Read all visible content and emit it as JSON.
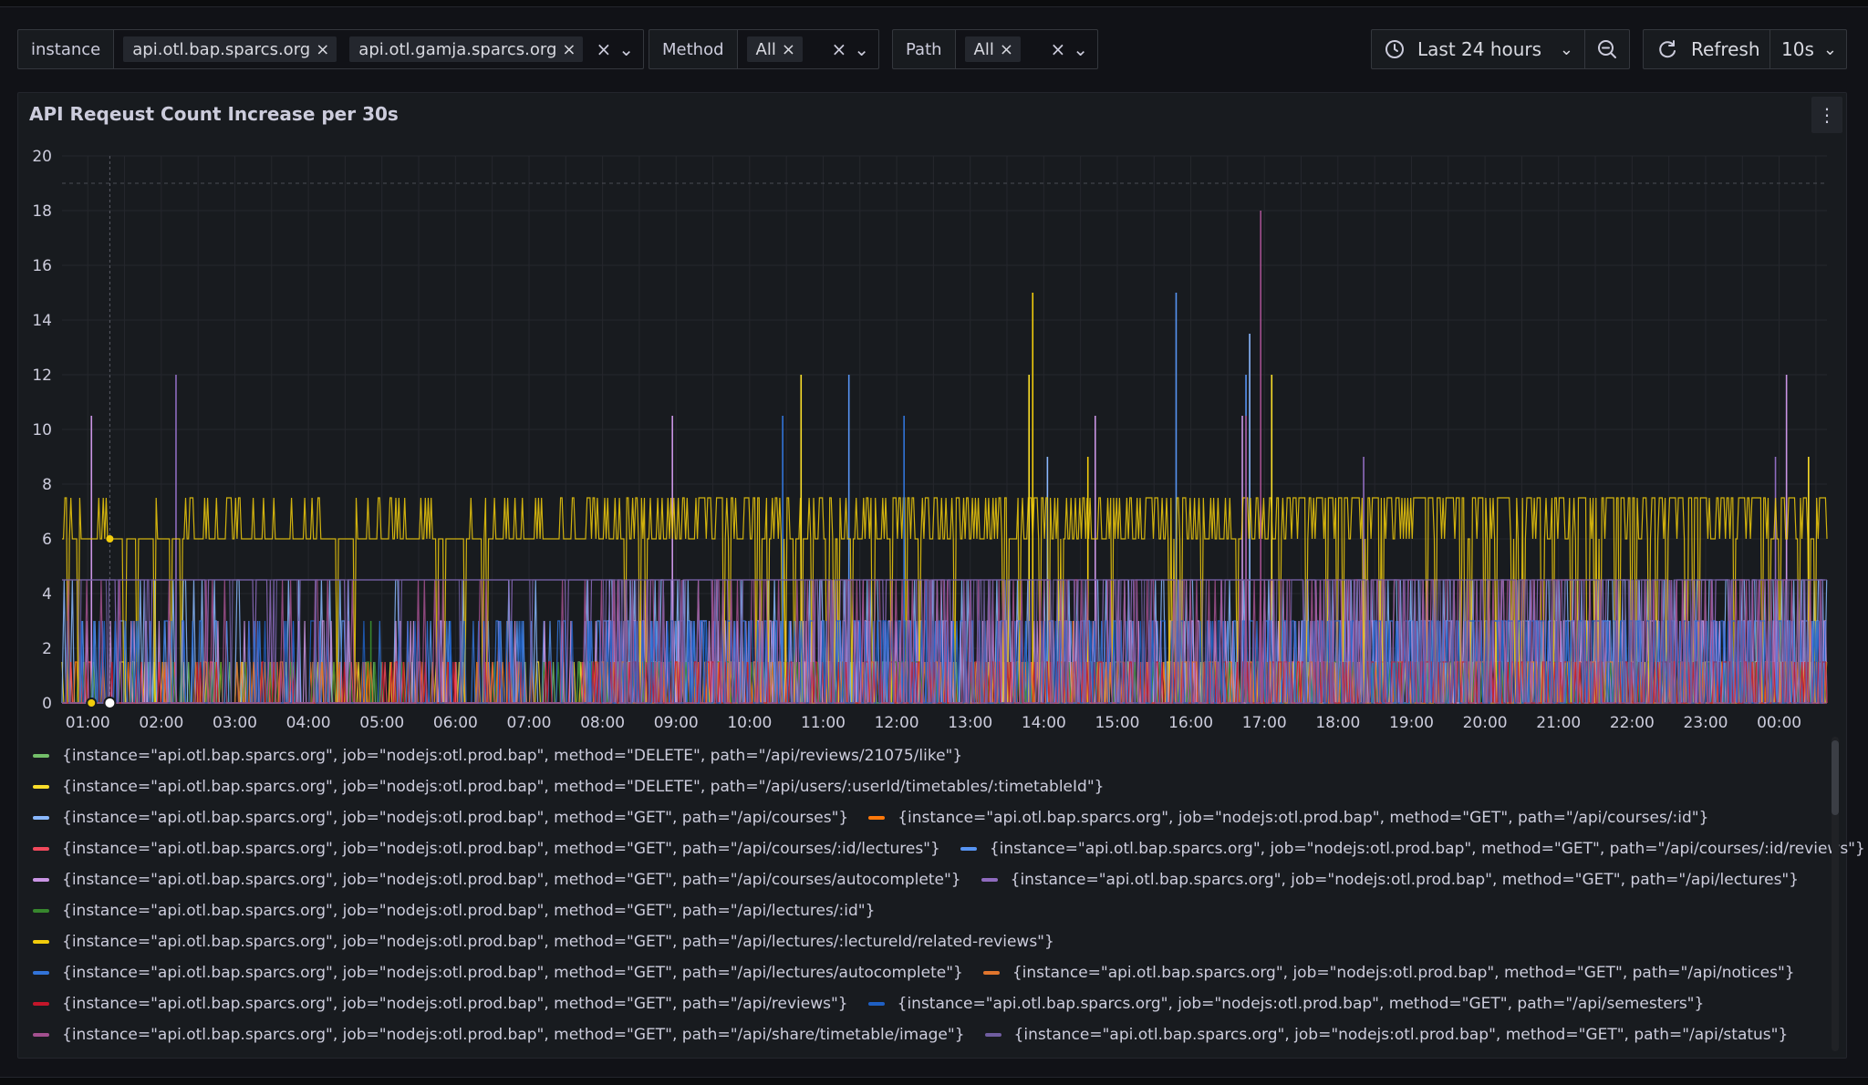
{
  "toolbar": {
    "instance": {
      "label": "instance",
      "values": [
        "api.otl.bap.sparcs.org",
        "api.otl.gamja.sparcs.org"
      ]
    },
    "method": {
      "label": "Method",
      "values": [
        "All"
      ]
    },
    "path": {
      "label": "Path",
      "values": [
        "All"
      ]
    },
    "time_range": "Last 24 hours",
    "refresh_label": "Refresh",
    "refresh_interval": "10s"
  },
  "panel": {
    "title": "API Reqeust Count Increase per 30s"
  },
  "chart_data": {
    "type": "line",
    "title": "API Reqeust Count Increase per 30s",
    "xlabel": "",
    "ylabel": "",
    "ylim": [
      0,
      20
    ],
    "yticks": [
      "0",
      "2",
      "4",
      "6",
      "8",
      "10",
      "12",
      "14",
      "16",
      "18",
      "20"
    ],
    "xticks": [
      "01:00",
      "02:00",
      "03:00",
      "04:00",
      "05:00",
      "06:00",
      "07:00",
      "08:00",
      "09:00",
      "10:00",
      "11:00",
      "12:00",
      "13:00",
      "14:00",
      "15:00",
      "16:00",
      "17:00",
      "18:00",
      "19:00",
      "20:00",
      "21:00",
      "22:00",
      "23:00",
      "00:00"
    ],
    "x_range_hours": [
      0.65,
      24.65
    ],
    "threshold_y": 19,
    "grid": true,
    "legend_position": "bottom",
    "series": [
      {
        "name": "{instance=\"api.otl.bap.sparcs.org\", job=\"nodejs:otl.prod.bap\", method=\"DELETE\", path=\"/api/reviews/21075/like\"}",
        "color": "#73bf69",
        "level": 1.5,
        "base": 0,
        "spikes": [
          [
            16.85,
            3
          ],
          [
            23.7,
            3
          ]
        ]
      },
      {
        "name": "{instance=\"api.otl.bap.sparcs.org\", job=\"nodejs:otl.prod.bap\", method=\"DELETE\", path=\"/api/users/:userId/timetables/:timetableId\"}",
        "color": "#fade2a",
        "level": 1.5,
        "base": 0,
        "spikes": [
          [
            10.7,
            12
          ],
          [
            13.8,
            12
          ],
          [
            17.1,
            12
          ],
          [
            24.4,
            9
          ]
        ]
      },
      {
        "name": "{instance=\"api.otl.bap.sparcs.org\", job=\"nodejs:otl.prod.bap\", method=\"GET\", path=\"/api/courses\"}",
        "color": "#8ab8ff",
        "level": 4.5,
        "base": 0,
        "spikes": [
          [
            14.05,
            9
          ],
          [
            16.8,
            13.5
          ]
        ]
      },
      {
        "name": "{instance=\"api.otl.bap.sparcs.org\", job=\"nodejs:otl.prod.bap\", method=\"GET\", path=\"/api/courses/:id\"}",
        "color": "#ff780a",
        "level": 1.5,
        "base": 0,
        "spikes": [
          [
            9.7,
            3
          ],
          [
            14.4,
            3
          ]
        ]
      },
      {
        "name": "{instance=\"api.otl.bap.sparcs.org\", job=\"nodejs:otl.prod.bap\", method=\"GET\", path=\"/api/courses/:id/lectures\"}",
        "color": "#f2495c",
        "level": 1.5,
        "base": 0,
        "spikes": [
          [
            6.0,
            1.5
          ],
          [
            11.3,
            1.5
          ]
        ]
      },
      {
        "name": "{instance=\"api.otl.bap.sparcs.org\", job=\"nodejs:otl.prod.bap\", method=\"GET\", path=\"/api/courses/:id/reviews\"}",
        "color": "#5794f2",
        "level": 3,
        "base": 0,
        "spikes": [
          [
            11.35,
            12
          ],
          [
            15.8,
            15
          ],
          [
            16.75,
            12
          ]
        ]
      },
      {
        "name": "{instance=\"api.otl.bap.sparcs.org\", job=\"nodejs:otl.prod.bap\", method=\"GET\", path=\"/api/courses/autocomplete\"}",
        "color": "#ca95e5",
        "level": 3,
        "base": 0,
        "spikes": [
          [
            1.05,
            10.5
          ],
          [
            8.95,
            10.5
          ],
          [
            14.7,
            10.5
          ],
          [
            16.7,
            10.5
          ],
          [
            24.1,
            12
          ]
        ]
      },
      {
        "name": "{instance=\"api.otl.bap.sparcs.org\", job=\"nodejs:otl.prod.bap\", method=\"GET\", path=\"/api/lectures\"}",
        "color": "#8f6bbf",
        "level": 4.5,
        "base": 4.5,
        "spikes": [
          [
            2.2,
            12
          ],
          [
            18.35,
            9
          ],
          [
            23.95,
            9
          ]
        ]
      },
      {
        "name": "{instance=\"api.otl.bap.sparcs.org\", job=\"nodejs:otl.prod.bap\", method=\"GET\", path=\"/api/lectures/:id\"}",
        "color": "#37872d",
        "level": 1.5,
        "base": 0,
        "spikes": [
          [
            4.85,
            3
          ]
        ]
      },
      {
        "name": "{instance=\"api.otl.bap.sparcs.org\", job=\"nodejs:otl.prod.bap\", method=\"GET\", path=\"/api/lectures/:lectureId/related-reviews\"}",
        "color": "#f2cc0c",
        "level": 7.5,
        "base": 6,
        "spikes": [
          [
            13.85,
            15
          ],
          [
            14.6,
            9
          ]
        ]
      },
      {
        "name": "{instance=\"api.otl.bap.sparcs.org\", job=\"nodejs:otl.prod.bap\", method=\"GET\", path=\"/api/lectures/autocomplete\"}",
        "color": "#3274d9",
        "level": 3,
        "base": 0,
        "spikes": [
          [
            10.45,
            10.5
          ],
          [
            12.1,
            10.5
          ]
        ]
      },
      {
        "name": "{instance=\"api.otl.bap.sparcs.org\", job=\"nodejs:otl.prod.bap\", method=\"GET\", path=\"/api/notices\"}",
        "color": "#e0752d",
        "level": 1.5,
        "base": 0,
        "spikes": [
          [
            6.7,
            3
          ]
        ]
      },
      {
        "name": "{instance=\"api.otl.bap.sparcs.org\", job=\"nodejs:otl.prod.bap\", method=\"GET\", path=\"/api/reviews\"}",
        "color": "#c4162a",
        "level": 1.5,
        "base": 0,
        "spikes": [
          [
            5.9,
            1.5
          ]
        ]
      },
      {
        "name": "{instance=\"api.otl.bap.sparcs.org\", job=\"nodejs:otl.prod.bap\", method=\"GET\", path=\"/api/semesters\"}",
        "color": "#1f60c4",
        "level": 3,
        "base": 0,
        "spikes": [
          [
            12.4,
            4.5
          ]
        ]
      },
      {
        "name": "{instance=\"api.otl.bap.sparcs.org\", job=\"nodejs:otl.prod.bap\", method=\"GET\", path=\"/api/share/timetable/image\"}",
        "color": "#a3508f",
        "level": 4.5,
        "base": 0,
        "spikes": [
          [
            16.95,
            18
          ],
          [
            16.75,
            10.5
          ]
        ]
      },
      {
        "name": "{instance=\"api.otl.bap.sparcs.org\", job=\"nodejs:otl.prod.bap\", method=\"GET\", path=\"/api/status\"}",
        "color": "#705da0",
        "level": 4.5,
        "base": 4.5,
        "spikes": [
          [
            4.1,
            4.5
          ]
        ]
      }
    ]
  }
}
